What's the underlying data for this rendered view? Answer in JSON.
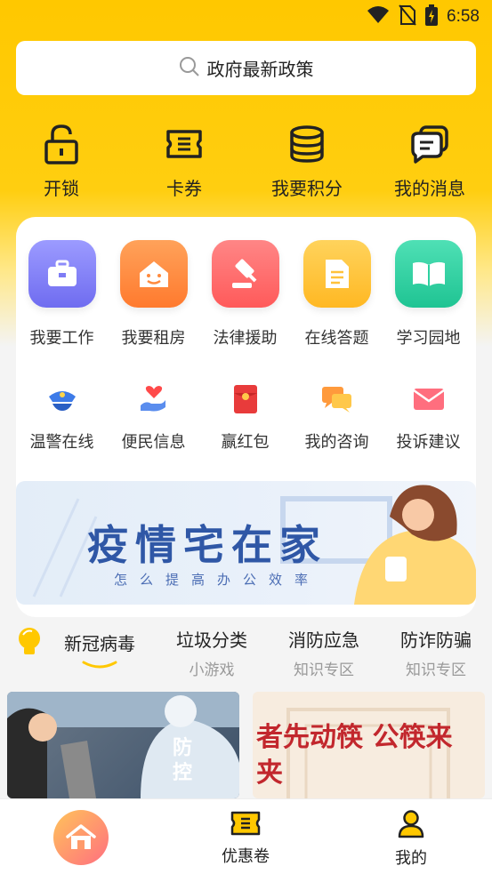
{
  "status_bar": {
    "time": "6:58"
  },
  "search": {
    "placeholder": "政府最新政策"
  },
  "quick_actions": [
    {
      "label": "开锁",
      "icon": "unlock-icon"
    },
    {
      "label": "卡券",
      "icon": "ticket-icon"
    },
    {
      "label": "我要积分",
      "icon": "coins-icon"
    },
    {
      "label": "我的消息",
      "icon": "message-icon"
    }
  ],
  "services": [
    {
      "label": "我要工作",
      "icon": "briefcase-icon",
      "color": "#7E7CF5"
    },
    {
      "label": "我要租房",
      "icon": "house-smile-icon",
      "color": "#FF8A3D"
    },
    {
      "label": "法律援助",
      "icon": "gavel-icon",
      "color": "#FF6B6B"
    },
    {
      "label": "在线答题",
      "icon": "document-icon",
      "color": "#FFC23A"
    },
    {
      "label": "学习园地",
      "icon": "book-icon",
      "color": "#2DD1A0"
    }
  ],
  "more_services": [
    {
      "label": "温警在线",
      "icon": "police-cap-icon"
    },
    {
      "label": "便民信息",
      "icon": "heart-hand-icon"
    },
    {
      "label": "赢红包",
      "icon": "red-envelope-icon"
    },
    {
      "label": "我的咨询",
      "icon": "chat-icon"
    },
    {
      "label": "投诉建议",
      "icon": "mail-icon"
    }
  ],
  "banner": {
    "title": "疫情宅在家",
    "subtitle": "怎么提高办公效率"
  },
  "tabs": [
    {
      "title": "新冠病毒",
      "sub": ""
    },
    {
      "title": "垃圾分类",
      "sub": "小游戏"
    },
    {
      "title": "消防应急",
      "sub": "知识专区"
    },
    {
      "title": "防诈防骗",
      "sub": "知识专区"
    }
  ],
  "news": [
    {
      "caption": "防控"
    },
    {
      "caption": "者先动筷 公筷来夹"
    }
  ],
  "bottom_nav": [
    {
      "label": "",
      "icon": "home-icon"
    },
    {
      "label": "优惠卷",
      "icon": "ticket-icon"
    },
    {
      "label": "我的",
      "icon": "user-icon"
    }
  ]
}
